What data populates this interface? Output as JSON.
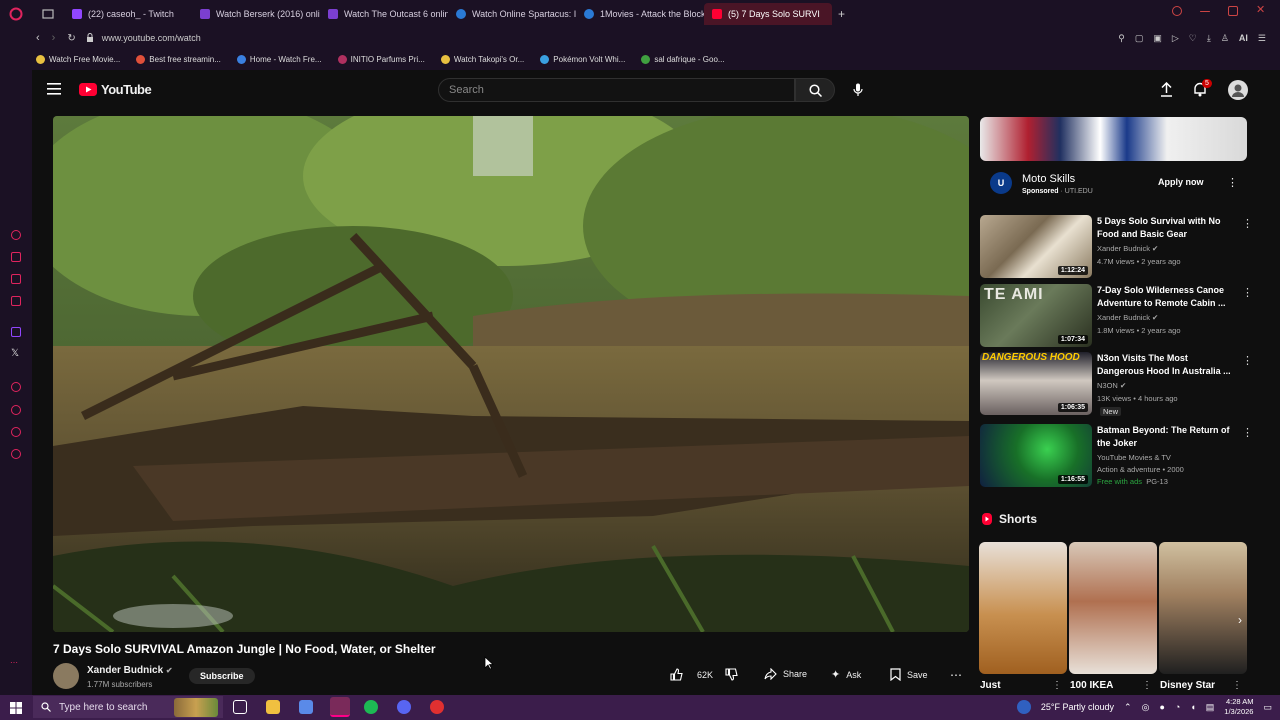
{
  "browser": {
    "tabs": [
      {
        "label": "(22) caseoh_ - Twitch",
        "color": "#9146ff"
      },
      {
        "label": "Watch Berserk (2016) onli",
        "color": "#7b3fd0"
      },
      {
        "label": "Watch The Outcast 6 onlin",
        "color": "#7b3fd0"
      },
      {
        "label": "Watch Online Spartacus: I",
        "color": "#2a7ad5"
      },
      {
        "label": "1Movies - Attack the Block",
        "color": "#2a7ad5"
      },
      {
        "label": "(5) 7 Days Solo SURVI",
        "color": "#ff0033"
      }
    ],
    "address": "www.youtube.com/watch",
    "ai_label": "AI",
    "bookmarks": [
      {
        "label": "Watch Free Movie...",
        "color": "#e8c040"
      },
      {
        "label": "Best free streamin...",
        "color": "#e0503a"
      },
      {
        "label": "Home - Watch Fre...",
        "color": "#3a80e0"
      },
      {
        "label": "INITIO Parfums Pri...",
        "color": "#b03060"
      },
      {
        "label": "Watch Takopi's Or...",
        "color": "#e8c040"
      },
      {
        "label": "Pokémon Volt Whi...",
        "color": "#3aa0e0"
      },
      {
        "label": "sal dafrique - Goo...",
        "color": "#40a040"
      }
    ]
  },
  "youtube": {
    "logo_text": "YouTube",
    "search_placeholder": "Search",
    "notification_count": "5",
    "video": {
      "title": "7 Days Solo SURVIVAL Amazon Jungle | No Food, Water, or Shelter",
      "channel": "Xander Budnick",
      "subscribers": "1.77M subscribers",
      "subscribe_label": "Subscribe",
      "likes": "62K",
      "share_label": "Share",
      "ask_label": "Ask",
      "save_label": "Save"
    },
    "ad": {
      "title": "Moto Skills",
      "sponsored": "Sponsored",
      "domain": "UTI.EDU",
      "cta": "Apply now",
      "logo_text": "U"
    },
    "recommendations": [
      {
        "title": "5 Days Solo Survival with No Food and Basic Gear",
        "channel": "Xander Budnick",
        "meta": "4.7M views • 2 years ago",
        "duration": "1:12:24",
        "extra": ""
      },
      {
        "title": "7-Day Solo Wilderness Canoe Adventure to Remote Cabin ...",
        "channel": "Xander Budnick",
        "meta": "1.8M views • 2 years ago",
        "duration": "1:07:34",
        "extra": ""
      },
      {
        "title": "N3on Visits The Most Dangerous Hood In Australia ...",
        "channel": "N3ON",
        "meta": "13K views • 4 hours ago",
        "duration": "1:06:35",
        "extra": "New"
      },
      {
        "title": "Batman Beyond: The Return of the Joker",
        "channel": "YouTube Movies & TV",
        "meta": "Action & adventure • 2000",
        "duration": "1:16:55",
        "extra": "Free with ads",
        "rating": "PG-13"
      }
    ],
    "shorts_header": "Shorts",
    "shorts": [
      {
        "label": "Just"
      },
      {
        "label": "100 IKEA"
      },
      {
        "label": "Disney Star"
      }
    ]
  },
  "taskbar": {
    "search_placeholder": "Type here to search",
    "weather": "25°F  Partly cloudy",
    "time": "4:28 AM",
    "date": "1/3/2026"
  }
}
